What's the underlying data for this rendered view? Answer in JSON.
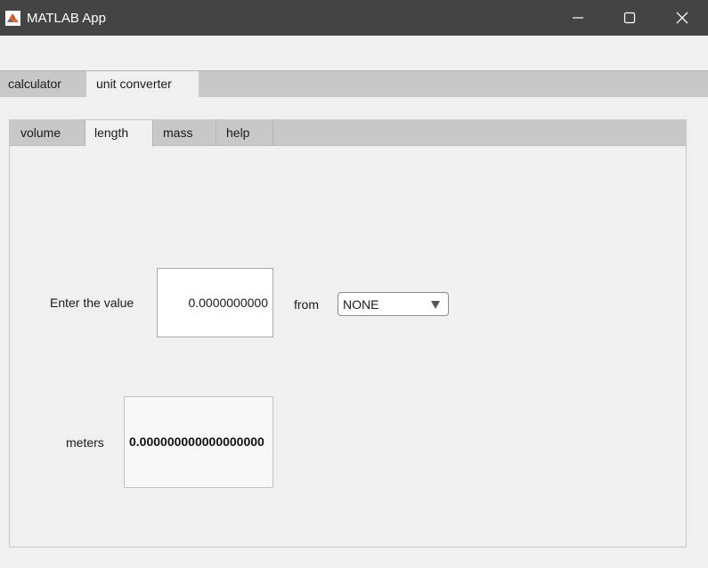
{
  "window": {
    "title": "MATLAB App",
    "icon": "matlab-logo-icon",
    "controls": [
      "minimize-icon",
      "maximize-icon",
      "close-icon"
    ]
  },
  "outer_tabs": [
    {
      "label": "calculator",
      "selected": false
    },
    {
      "label": "unit converter",
      "selected": true
    }
  ],
  "inner_tabs": [
    {
      "label": "volume",
      "selected": false
    },
    {
      "label": "length",
      "selected": true
    },
    {
      "label": "mass",
      "selected": false
    },
    {
      "label": "help",
      "selected": false
    }
  ],
  "length_panel": {
    "enter_label": "Enter the value",
    "input_value": "0.0000000000",
    "from_label": "from",
    "unit_selected": "NONE",
    "result_label": "meters",
    "result_value": "0.000000000000000000"
  },
  "colors": {
    "titlebar": "#454444",
    "tab_strip": "#c8c8c8",
    "background": "#f0f0f0"
  }
}
